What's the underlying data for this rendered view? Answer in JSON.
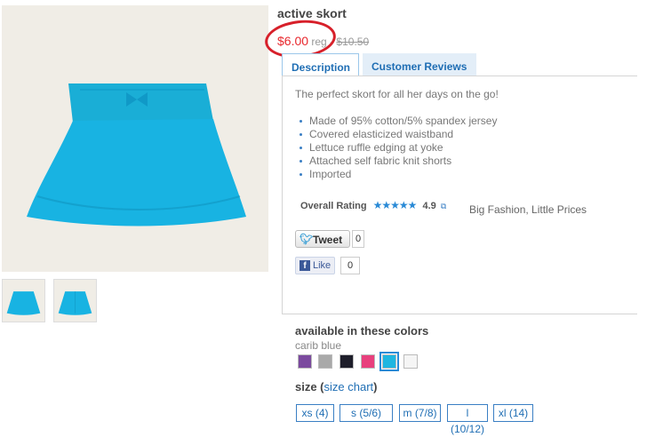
{
  "product": {
    "title": "active skort",
    "sale_price": "$6.00",
    "reg_label": "reg -",
    "reg_price": "$10.50"
  },
  "tabs": [
    {
      "label": "Description",
      "active": true
    },
    {
      "label": "Customer Reviews",
      "active": false
    }
  ],
  "description": {
    "text": "The perfect skort for all her days on the go!",
    "bullets": [
      "Made of 95% cotton/5% spandex jersey",
      "Covered elasticized waistband",
      "Lettuce ruffle edging at yoke",
      "Attached self fabric knit shorts",
      "Imported"
    ]
  },
  "rating": {
    "label": "Overall Rating",
    "stars": "★★★★★",
    "value": "4.9",
    "tagline": "Big Fashion, Little Prices"
  },
  "social": {
    "tweet_label": "Tweet",
    "tweet_count": "0",
    "like_label": "Like",
    "like_count": "0"
  },
  "colors": {
    "heading": "available in these colors",
    "selected_name": "carib blue",
    "swatches": [
      {
        "name": "purple",
        "hex": "#7b4a9e"
      },
      {
        "name": "gray",
        "hex": "#a9a9a9"
      },
      {
        "name": "black",
        "hex": "#1e1e2a"
      },
      {
        "name": "pink",
        "hex": "#e8407d"
      },
      {
        "name": "carib blue",
        "hex": "#1fb6e0",
        "selected": true
      },
      {
        "name": "white",
        "hex": "#f5f5f5"
      }
    ]
  },
  "size": {
    "heading": "size (",
    "chart_link": "size chart",
    "heading_end": ")",
    "options": [
      "xs (4)",
      "s (5/6)",
      "m (7/8)",
      "l (10/12)",
      "xl (14)"
    ]
  }
}
